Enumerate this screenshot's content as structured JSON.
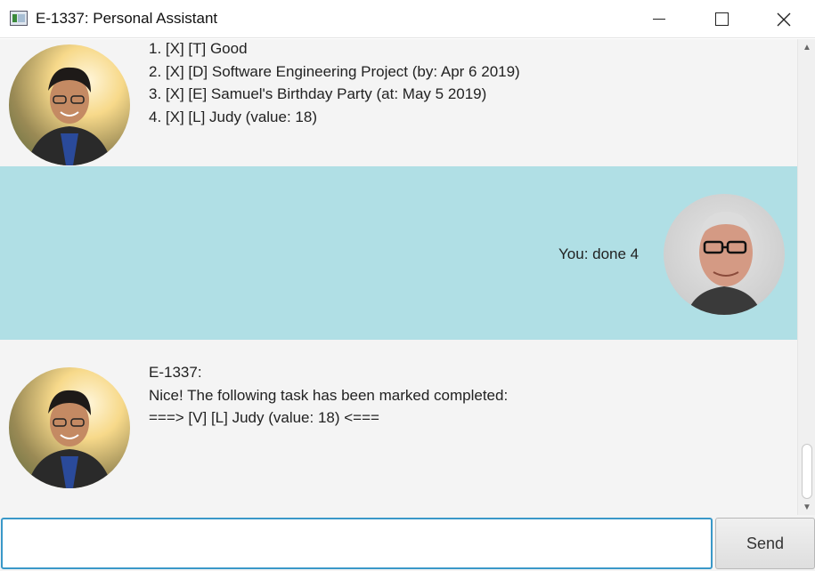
{
  "window": {
    "title": "E-1337: Personal Assistant"
  },
  "dialog": [
    {
      "sender": "bot",
      "lines": [
        "1. [X] [T] Good",
        "2. [X] [D] Software Engineering Project (by: Apr 6 2019)",
        "3. [X] [E] Samuel's Birthday Party (at: May 5 2019)",
        "4. [X] [L] Judy (value: 18)"
      ]
    },
    {
      "sender": "user",
      "text": "You: done 4"
    },
    {
      "sender": "bot",
      "lines": [
        "E-1337:",
        "Nice! The following task has been marked completed:",
        "===> [V] [L] Judy (value: 18) <==="
      ]
    }
  ],
  "input": {
    "value": ""
  },
  "send_button": {
    "label": "Send"
  },
  "colors": {
    "user_bubble": "#b0dfe5",
    "bot_bubble": "#f4f4f4",
    "input_focus": "#3a98c8"
  }
}
